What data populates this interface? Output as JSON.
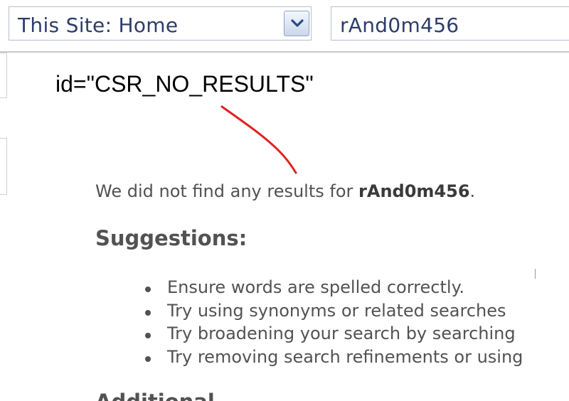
{
  "search": {
    "scope_label": "This Site: Home",
    "query": "rAnd0m456"
  },
  "annotation": {
    "text": "id=\"CSR_NO_RESULTS\"",
    "arrow_color": "#e02020"
  },
  "results": {
    "message_prefix": "We did not find any results for ",
    "query": "rAnd0m456",
    "message_suffix": "."
  },
  "suggestions": {
    "heading": "Suggestions:",
    "items": [
      {
        "text": "Ensure words are spelled correctly."
      },
      {
        "text": "Try using synonyms or related searches"
      },
      {
        "text": "Try broadening your search by searching"
      },
      {
        "text": "Try removing search refinements or using"
      }
    ]
  },
  "additional": {
    "heading": "Additional"
  },
  "colors": {
    "scope_text": "#2d3d6b",
    "body_text": "#525252",
    "annotation_arrow": "#e02020"
  }
}
